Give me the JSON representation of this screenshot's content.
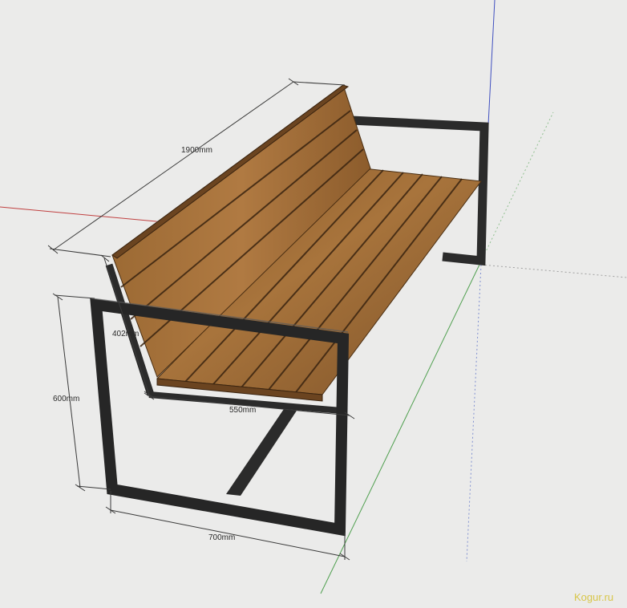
{
  "dimensions": {
    "length": "1900mm",
    "back_height": "402mm",
    "height": "600mm",
    "seat_depth": "550mm",
    "width": "700mm"
  },
  "watermark": "Kogur.ru",
  "colors": {
    "background": "#ebebea",
    "steel": "#2b2b2b",
    "wood": "#9a6a36",
    "wood_dark": "#5a3a1a",
    "axis_red": "#c04040",
    "axis_green": "#50a050",
    "axis_blue": "#4050c0"
  }
}
